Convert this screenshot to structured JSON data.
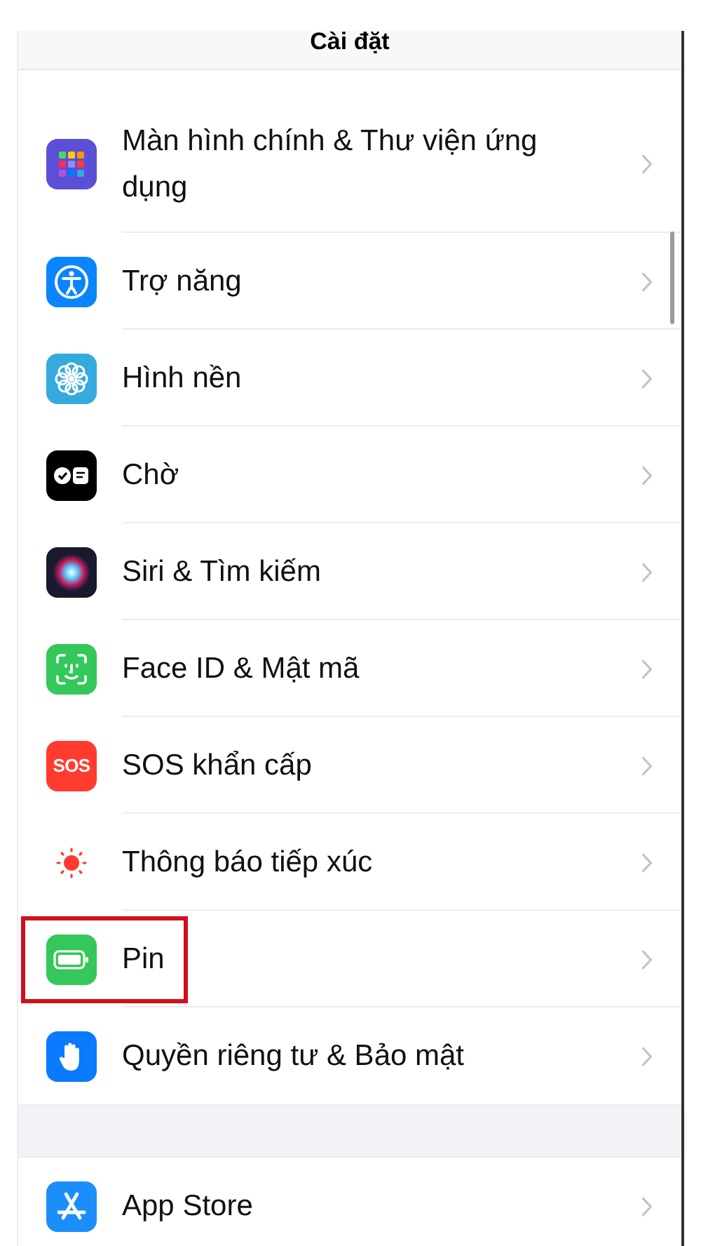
{
  "header": {
    "title": "Cài đặt"
  },
  "groups": [
    {
      "items": [
        {
          "kind": "grid",
          "label": "Màn hình chính & Thư viện ứng dụng",
          "highlighted": false
        },
        {
          "kind": "accessibility",
          "label": "Trợ năng",
          "highlighted": false
        },
        {
          "kind": "flower",
          "label": "Hình nền",
          "highlighted": false
        },
        {
          "kind": "standby",
          "label": "Chờ",
          "highlighted": false
        },
        {
          "kind": "siri",
          "label": "Siri & Tìm kiếm",
          "highlighted": false
        },
        {
          "kind": "faceid",
          "label": "Face ID & Mật mã",
          "highlighted": false
        },
        {
          "kind": "sos",
          "icon_label": "SOS",
          "label": "SOS khẩn cấp",
          "highlighted": false
        },
        {
          "kind": "exposure",
          "label": "Thông báo tiếp xúc",
          "highlighted": false
        },
        {
          "kind": "battery",
          "label": "Pin",
          "highlighted": true
        },
        {
          "kind": "hand",
          "label": "Quyền riêng tư & Bảo mật",
          "highlighted": false
        }
      ]
    },
    {
      "items": [
        {
          "kind": "appstore",
          "label": "App Store",
          "highlighted": false
        }
      ]
    }
  ]
}
